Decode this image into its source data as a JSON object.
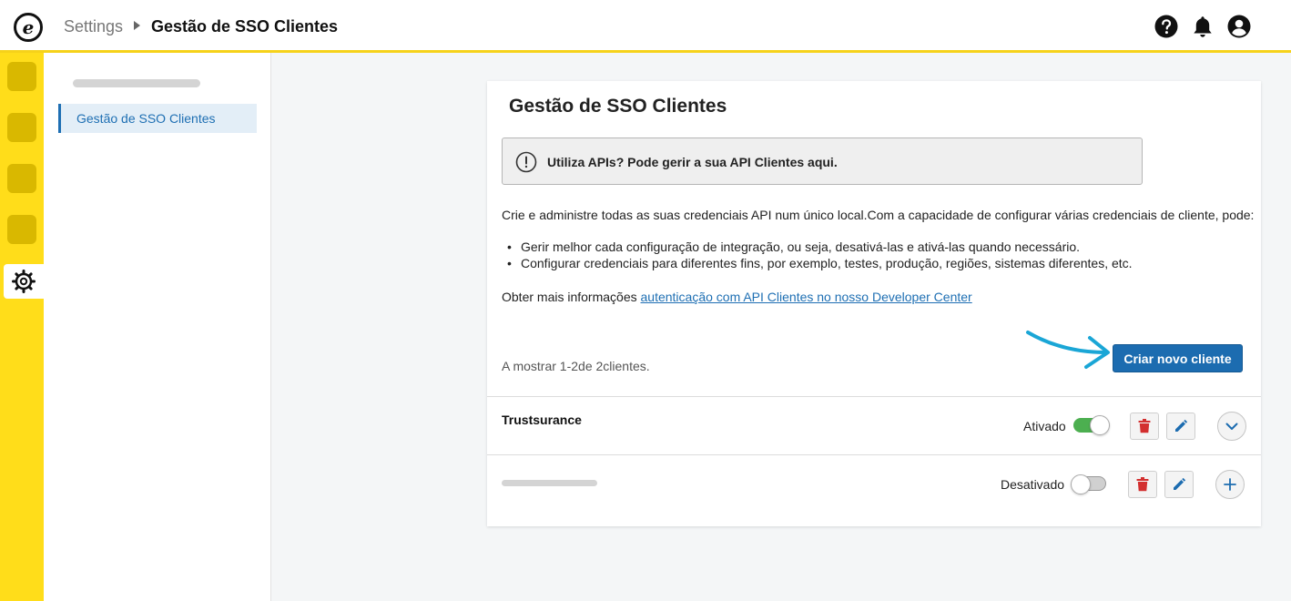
{
  "header": {
    "logo_letter": "e",
    "breadcrumb_root": "Settings",
    "breadcrumb_current": "Gestão de SSO Clientes",
    "icons": [
      "help-icon",
      "bell-icon",
      "user-account-icon"
    ]
  },
  "sidebar": {
    "items": [
      {
        "label": "Gestão de SSO Clientes",
        "selected": true
      }
    ]
  },
  "rail": {
    "active_icon": "gear-icon"
  },
  "main": {
    "title": "Gestão de SSO Clientes",
    "alert": "Utiliza APIs? Pode gerir a sua API Clientes aqui.",
    "description": "Crie e administre todas as suas credenciais API num único local.Com a capacidade de configurar várias credenciais de cliente, pode:",
    "bullets": [
      "Gerir melhor cada configuração de integração, ou seja, desativá-las e ativá-las quando necessário.",
      "Configurar credenciais para diferentes fins, por exemplo, testes, produção, regiões, sistemas diferentes, etc."
    ],
    "more_info_prefix": "Obter mais informações ",
    "more_info_link": "autenticação com API Clientes no nosso Developer Center",
    "create_button": "Criar novo cliente",
    "showing": "A mostrar 1-2de 2clientes."
  },
  "clients": [
    {
      "name": "Trustsurance",
      "status": "Ativado",
      "enabled": true,
      "expand_icon": "chevron-down-icon"
    },
    {
      "name": "",
      "status": "Desativado",
      "enabled": false,
      "expand_icon": "plus-icon"
    }
  ],
  "colors": {
    "accent_yellow": "#ffdd1a",
    "primary_blue": "#1c6cb0",
    "toggle_on": "#4caf50",
    "delete_red": "#d32f2f",
    "annotation_arrow": "#1aa6d6"
  }
}
